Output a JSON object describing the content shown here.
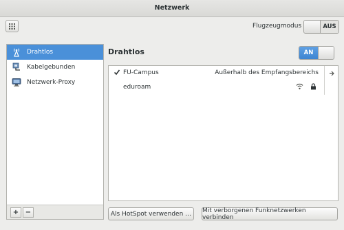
{
  "window": {
    "title": "Netzwerk"
  },
  "header": {
    "airplane_label": "Flugzeugmodus",
    "airplane_toggle_state": "AUS"
  },
  "sidebar": {
    "items": [
      {
        "label": "Drahtlos",
        "icon": "wireless-antenna-icon",
        "selected": true
      },
      {
        "label": "Kabelgebunden",
        "icon": "wired-network-icon",
        "selected": false
      },
      {
        "label": "Netzwerk-Proxy",
        "icon": "network-proxy-icon",
        "selected": false
      }
    ],
    "add_label": "+",
    "remove_label": "−"
  },
  "main": {
    "heading": "Drahtlos",
    "wifi_toggle_state": "AN",
    "networks": [
      {
        "name": "FU-Campus",
        "status": "Außerhalb des Empfangsbereichs",
        "connected": true
      },
      {
        "name": "eduroam",
        "status": "",
        "secured": true
      }
    ]
  },
  "footer": {
    "hotspot_button": "Als HotSpot verwenden …",
    "hidden_button": "Mit verborgenen Funknetzwerken verbinden"
  },
  "colors": {
    "accent": "#4a90d9",
    "background": "#ededeb"
  }
}
